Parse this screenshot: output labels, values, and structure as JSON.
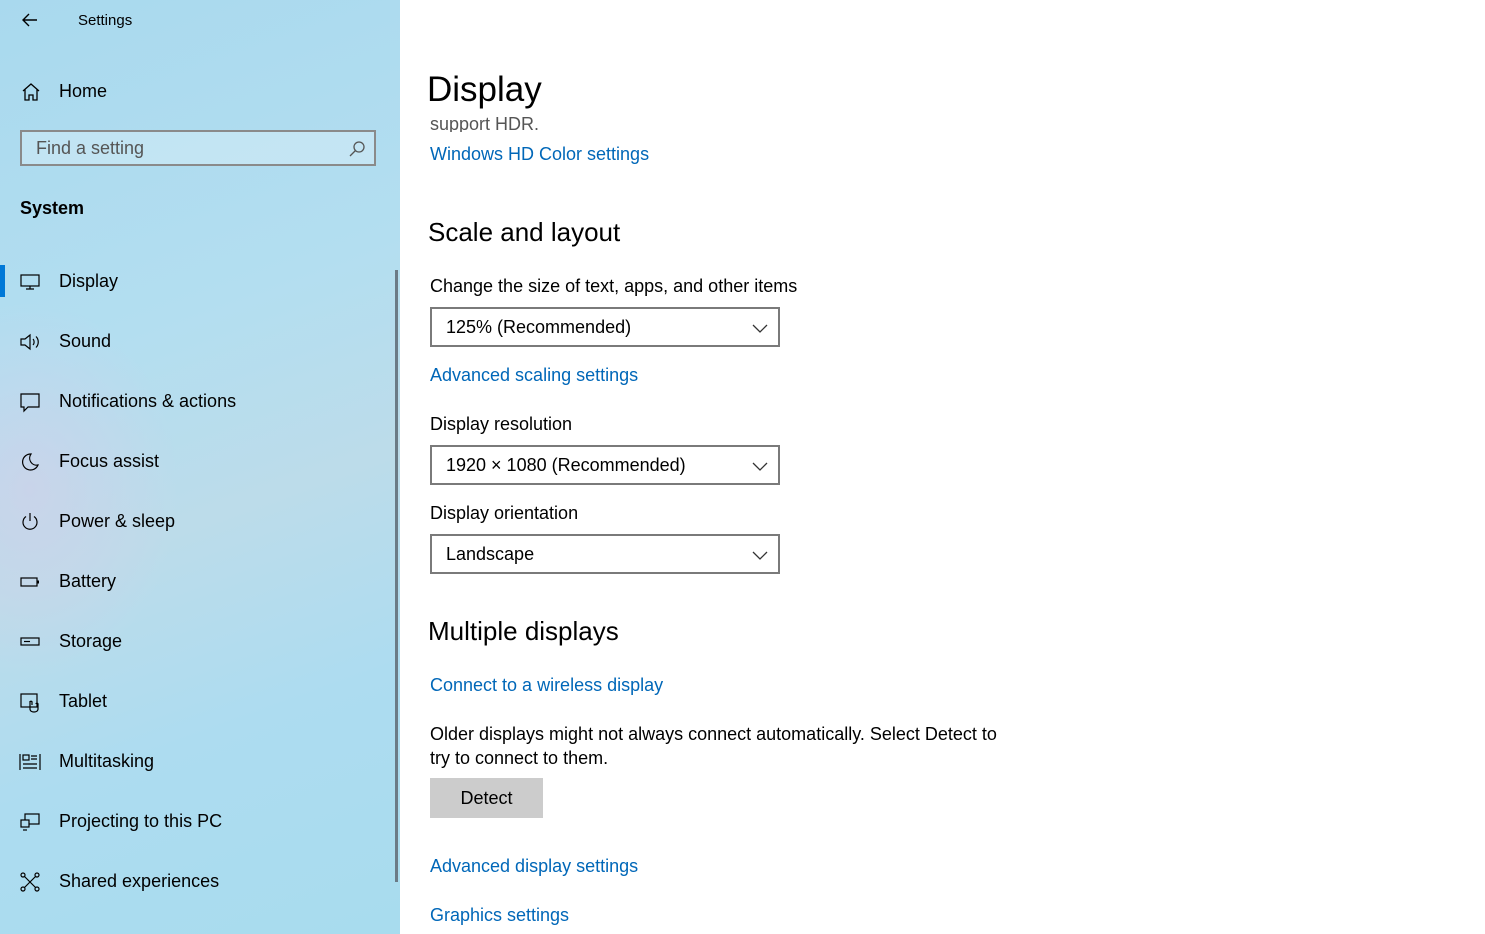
{
  "window": {
    "title": "Settings"
  },
  "sidebar": {
    "home_label": "Home",
    "search_placeholder": "Find a setting",
    "section_label": "System",
    "items": [
      {
        "label": "Display",
        "icon": "monitor-icon",
        "active": true
      },
      {
        "label": "Sound",
        "icon": "speaker-icon"
      },
      {
        "label": "Notifications & actions",
        "icon": "notification-icon"
      },
      {
        "label": "Focus assist",
        "icon": "moon-icon"
      },
      {
        "label": "Power & sleep",
        "icon": "power-icon"
      },
      {
        "label": "Battery",
        "icon": "battery-icon"
      },
      {
        "label": "Storage",
        "icon": "storage-icon"
      },
      {
        "label": "Tablet",
        "icon": "tablet-icon"
      },
      {
        "label": "Multitasking",
        "icon": "multitasking-icon"
      },
      {
        "label": "Projecting to this PC",
        "icon": "projecting-icon"
      },
      {
        "label": "Shared experiences",
        "icon": "shared-experiences-icon"
      }
    ]
  },
  "main": {
    "title": "Display",
    "cut_off_text": "support HDR.",
    "hd_color_link": "Windows HD Color settings",
    "scale_heading": "Scale and layout",
    "scale_label": "Change the size of text, apps, and other items",
    "scale_value": "125% (Recommended)",
    "advanced_scaling_link": "Advanced scaling settings",
    "resolution_label": "Display resolution",
    "resolution_value": "1920 × 1080 (Recommended)",
    "orientation_label": "Display orientation",
    "orientation_value": "Landscape",
    "multiple_heading": "Multiple displays",
    "wireless_link": "Connect to a wireless display",
    "detect_text": "Older displays might not always connect automatically. Select Detect to try to connect to them.",
    "detect_button": "Detect",
    "advanced_display_link": "Advanced display settings",
    "graphics_link": "Graphics settings"
  },
  "colors": {
    "accent": "#0078d7",
    "link": "#0067b8",
    "button": "#cccccc"
  }
}
